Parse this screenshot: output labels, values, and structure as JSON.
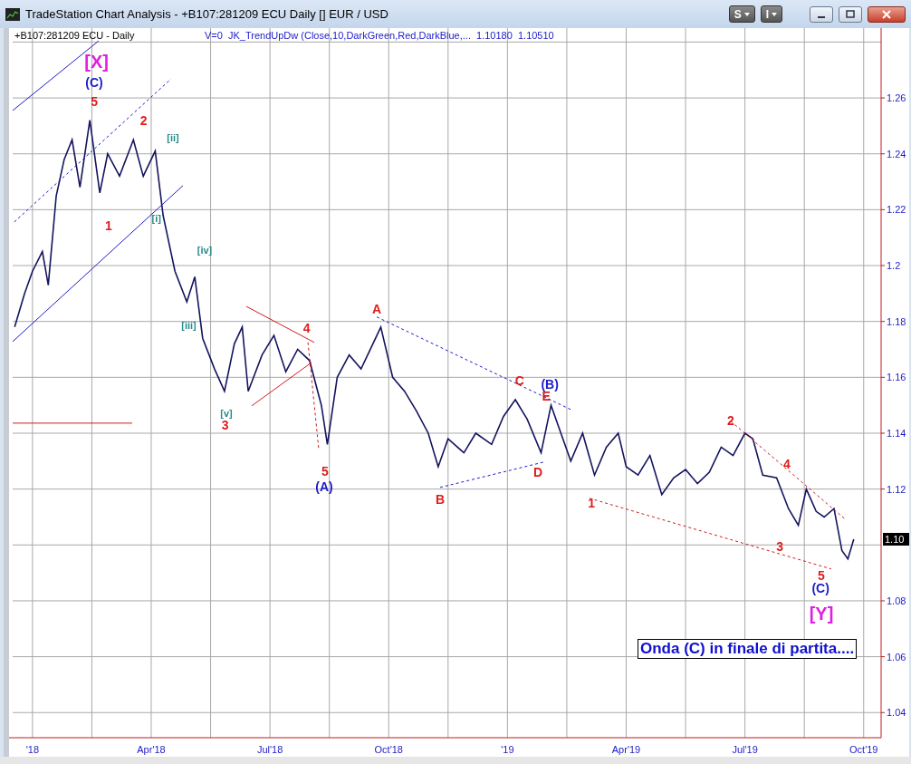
{
  "window": {
    "title": "TradeStation Chart Analysis - +B107:281209 ECU Daily [] EUR / USD",
    "toolbar_buttons": [
      {
        "label": "S"
      },
      {
        "label": "I"
      }
    ]
  },
  "chart": {
    "symbol_label": "+B107:281209 ECU - Daily",
    "indicator_label": "V=0  JK_TrendUpDw (Close,10,DarkGreen,Red,DarkBlue,...  1.10180  1.10510",
    "last_price": "1.10",
    "note": "Onda (C) in finale di partita....",
    "wave_labels": [
      {
        "text": "[X]",
        "color": "#e020e0",
        "kind": "major"
      },
      {
        "text": "(C)",
        "color": "#1c1cc8",
        "kind": "mid"
      },
      {
        "text": "5",
        "color": "#e01c1c",
        "kind": "mid"
      },
      {
        "text": "2",
        "color": "#e01c1c",
        "kind": "mid"
      },
      {
        "text": "[ii]",
        "color": "#2a8a8a",
        "kind": "minor"
      },
      {
        "text": "1",
        "color": "#e01c1c",
        "kind": "mid"
      },
      {
        "text": "[i]",
        "color": "#2a8a8a",
        "kind": "minor"
      },
      {
        "text": "[iv]",
        "color": "#2a8a8a",
        "kind": "minor"
      },
      {
        "text": "[iii]",
        "color": "#2a8a8a",
        "kind": "minor"
      },
      {
        "text": "[v]",
        "color": "#2a8a8a",
        "kind": "minor"
      },
      {
        "text": "3",
        "color": "#e01c1c",
        "kind": "mid"
      },
      {
        "text": "4",
        "color": "#e01c1c",
        "kind": "mid"
      },
      {
        "text": "A",
        "color": "#e01c1c",
        "kind": "mid"
      },
      {
        "text": "5",
        "color": "#e01c1c",
        "kind": "mid"
      },
      {
        "text": "(A)",
        "color": "#1c1cc8",
        "kind": "mid"
      },
      {
        "text": "C",
        "color": "#e01c1c",
        "kind": "mid"
      },
      {
        "text": "(B)",
        "color": "#1c1cc8",
        "kind": "mid"
      },
      {
        "text": "E",
        "color": "#e01c1c",
        "kind": "mid"
      },
      {
        "text": "D",
        "color": "#e01c1c",
        "kind": "mid"
      },
      {
        "text": "B",
        "color": "#e01c1c",
        "kind": "mid"
      },
      {
        "text": "1",
        "color": "#e01c1c",
        "kind": "mid"
      },
      {
        "text": "2",
        "color": "#e01c1c",
        "kind": "mid"
      },
      {
        "text": "4",
        "color": "#e01c1c",
        "kind": "mid"
      },
      {
        "text": "3",
        "color": "#e01c1c",
        "kind": "mid"
      },
      {
        "text": "5",
        "color": "#e01c1c",
        "kind": "mid"
      },
      {
        "text": "(C)",
        "color": "#1c1cc8",
        "kind": "mid"
      },
      {
        "text": "[Y]",
        "color": "#e020e0",
        "kind": "major"
      }
    ],
    "chart_data": {
      "type": "line",
      "grid": true,
      "xlim": [
        2017.9583,
        2019.7867
      ],
      "ylim": [
        1.031,
        1.285
      ],
      "xticks": [
        {
          "value": 2018,
          "label": "'18"
        },
        {
          "value": 2018.25,
          "label": "Apr'18"
        },
        {
          "value": 2018.5,
          "label": "Jul'18"
        },
        {
          "value": 2018.75,
          "label": "Oct'18"
        },
        {
          "value": 2019,
          "label": "'19"
        },
        {
          "value": 2019.25,
          "label": "Apr'19"
        },
        {
          "value": 2019.5,
          "label": "Jul'19"
        },
        {
          "value": 2019.75,
          "label": "Oct'19"
        }
      ],
      "yticks": [
        {
          "value": 1.04,
          "label": "1.04"
        },
        {
          "value": 1.06,
          "label": "1.06"
        },
        {
          "value": 1.08,
          "label": "1.08"
        },
        {
          "value": 1.12,
          "label": "1.12"
        },
        {
          "value": 1.14,
          "label": "1.14"
        },
        {
          "value": 1.16,
          "label": "1.16"
        },
        {
          "value": 1.18,
          "label": "1.18"
        },
        {
          "value": 1.2,
          "label": "1.2"
        },
        {
          "value": 1.22,
          "label": "1.22"
        },
        {
          "value": 1.24,
          "label": "1.24"
        },
        {
          "value": 1.26,
          "label": "1.26"
        }
      ],
      "x": [
        2017.9625,
        2017.9833,
        2018,
        2018.0208,
        2018.0333,
        2018.05,
        2018.0667,
        2018.0833,
        2018.1,
        2018.1208,
        2018.1417,
        2018.1583,
        2018.1833,
        2018.2125,
        2018.2333,
        2018.2583,
        2018.275,
        2018.3,
        2018.325,
        2018.3417,
        2018.3583,
        2018.3833,
        2018.4042,
        2018.425,
        2018.4417,
        2018.4542,
        2018.4833,
        2018.5083,
        2018.5333,
        2018.5583,
        2018.5833,
        2018.6083,
        2018.6208,
        2018.6417,
        2018.6667,
        2018.6917,
        2018.7167,
        2018.7333,
        2018.7583,
        2018.7833,
        2018.8083,
        2018.8333,
        2018.8542,
        2018.875,
        2018.9083,
        2018.9333,
        2018.9667,
        2018.9917,
        2019.0167,
        2019.0417,
        2019.0708,
        2019.0917,
        2019.1167,
        2019.1333,
        2019.1583,
        2019.1833,
        2019.2083,
        2019.2333,
        2019.25,
        2019.275,
        2019.3,
        2019.325,
        2019.35,
        2019.375,
        2019.4,
        2019.425,
        2019.45,
        2019.475,
        2019.5,
        2019.5167,
        2019.5375,
        2019.5667,
        2019.5917,
        2019.6125,
        2019.6292,
        2019.65,
        2019.6667,
        2019.6875,
        2019.7042,
        2019.7167,
        2019.7292
      ],
      "series": [
        {
          "color": "#14145e",
          "values": [
            1.178,
            1.19,
            1.198,
            1.205,
            1.193,
            1.225,
            1.238,
            1.245,
            1.228,
            1.252,
            1.226,
            1.24,
            1.232,
            1.245,
            1.232,
            1.241,
            1.218,
            1.198,
            1.187,
            1.196,
            1.174,
            1.163,
            1.155,
            1.172,
            1.178,
            1.155,
            1.168,
            1.175,
            1.162,
            1.17,
            1.166,
            1.15,
            1.136,
            1.16,
            1.168,
            1.163,
            1.172,
            1.178,
            1.16,
            1.155,
            1.148,
            1.14,
            1.128,
            1.138,
            1.133,
            1.14,
            1.136,
            1.146,
            1.152,
            1.145,
            1.133,
            1.15,
            1.138,
            1.13,
            1.14,
            1.125,
            1.135,
            1.14,
            1.128,
            1.125,
            1.132,
            1.118,
            1.124,
            1.127,
            1.122,
            1.126,
            1.135,
            1.132,
            1.14,
            1.138,
            1.125,
            1.124,
            1.113,
            1.107,
            1.12,
            1.112,
            1.11,
            1.113,
            1.098,
            1.095,
            1.102
          ]
        }
      ]
    }
  }
}
